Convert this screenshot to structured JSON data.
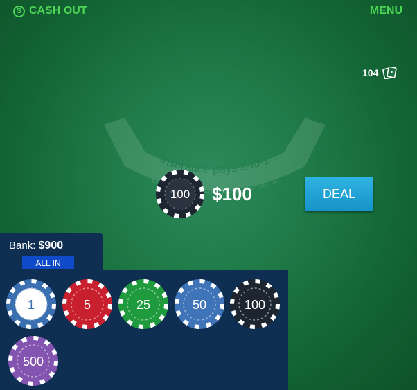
{
  "header": {
    "cashout_label": "CASH OUT",
    "cashout_icon": "dollar-circle-icon",
    "menu_label": "MENU"
  },
  "deck": {
    "count": "104",
    "icon": "cards-icon"
  },
  "table_label": {
    "line1": "Insurance pays 2-to-1",
    "line2": "BLACKJACK pays 3-to-2"
  },
  "bet": {
    "chip_value": "100",
    "amount": "$100"
  },
  "deal_label": "DEAL",
  "bank": {
    "label": "Bank:",
    "amount": "$900",
    "allin_label": "ALL IN"
  },
  "chips": [
    {
      "value": "1",
      "color": "#ffffff",
      "edge": "#3a6fb0",
      "text": "#3a6fb0"
    },
    {
      "value": "5",
      "color": "#c8202e",
      "edge": "#c8202e",
      "text": "#ffffff"
    },
    {
      "value": "25",
      "color": "#1f9b3e",
      "edge": "#1f9b3e",
      "text": "#ffffff"
    },
    {
      "value": "50",
      "color": "#3f74b8",
      "edge": "#3f74b8",
      "text": "#ffffff"
    },
    {
      "value": "100",
      "color": "#1d2530",
      "edge": "#1d2530",
      "text": "#ffffff"
    },
    {
      "value": "500",
      "color": "#8455b0",
      "edge": "#8455b0",
      "text": "#ffffff"
    }
  ],
  "colors": {
    "accent_green": "#4cd455",
    "felt": "#1f7a48",
    "panel": "#0f2f52",
    "deal": "#1fa3d6",
    "allin": "#0f4ac8"
  }
}
